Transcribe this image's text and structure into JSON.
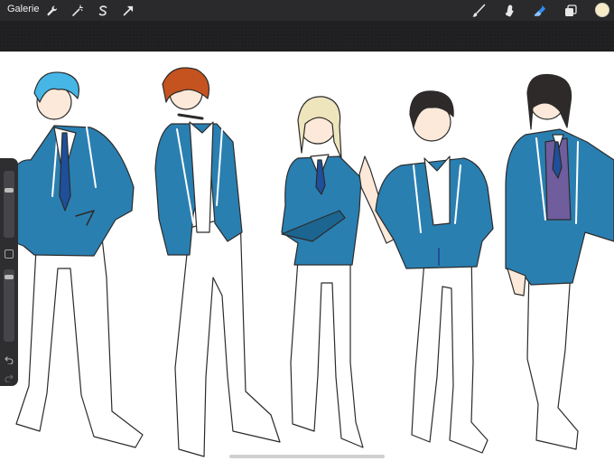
{
  "app": {
    "gallery_label": "Galerie"
  },
  "toolbar_left": [
    {
      "name": "wrench-icon"
    },
    {
      "name": "magic-wand-icon"
    },
    {
      "name": "selection-s-icon"
    },
    {
      "name": "transform-arrow-icon"
    }
  ],
  "toolbar_right": [
    {
      "name": "brush-icon"
    },
    {
      "name": "smudge-icon"
    },
    {
      "name": "eraser-icon"
    },
    {
      "name": "layers-icon"
    }
  ],
  "colors": {
    "active_color": "#f7ecc8",
    "eraser_active": "#2f8cf0",
    "jacket": "#2a7fb1",
    "jacket_dark": "#1c6590",
    "tie": "#1f4f9a",
    "vest": "#6f5d9e",
    "ink": "#2b2b2b"
  },
  "artwork": {
    "figures": [
      {
        "hair": "#45b6e6"
      },
      {
        "hair": "#c4531f"
      },
      {
        "hair": "#eee5bd"
      },
      {
        "hair": "#2f2a2a"
      },
      {
        "hair": "#2f2a2a"
      }
    ]
  }
}
